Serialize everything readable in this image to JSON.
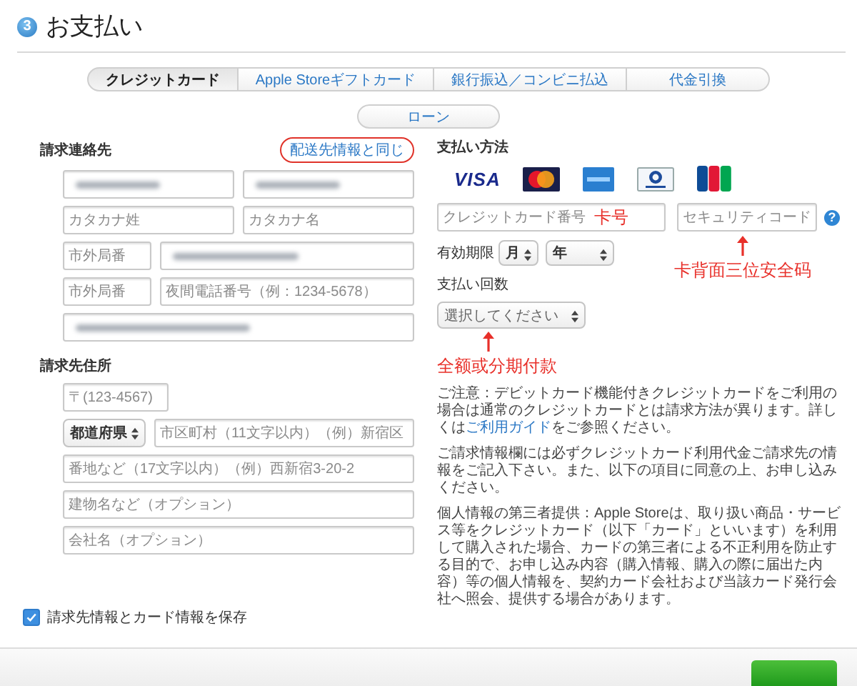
{
  "header": {
    "step": "3",
    "title": "お支払い"
  },
  "tabs": [
    {
      "label": "クレジットカード",
      "selected": true
    },
    {
      "label": "Apple Storeギフトカード",
      "selected": false
    },
    {
      "label": "銀行振込／コンビニ払込",
      "selected": false
    },
    {
      "label": "代金引換",
      "selected": false
    }
  ],
  "loan_button": "ローン",
  "billing_contact": {
    "heading": "請求連絡先",
    "same_as_shipping": {
      "label": "配送先情報と同じ",
      "circled": true
    },
    "rows": [
      [
        {
          "kind": "text",
          "redacted": true
        },
        {
          "kind": "text",
          "redacted": true
        }
      ],
      [
        {
          "kind": "text",
          "placeholder": "カタカナ姓",
          "redacted": false
        },
        {
          "kind": "text",
          "placeholder": "カタカナ名",
          "redacted": false
        }
      ],
      [
        {
          "kind": "area_code",
          "placeholder": "市外局番",
          "redacted": false
        },
        {
          "kind": "text",
          "redacted": true
        }
      ],
      [
        {
          "kind": "area_code",
          "placeholder": "市外局番",
          "redacted": false
        },
        {
          "kind": "text",
          "placeholder": "夜間電話番号（例：1234-5678）",
          "redacted": false
        }
      ],
      [
        {
          "kind": "text",
          "redacted": true
        }
      ]
    ]
  },
  "billing_address": {
    "heading": "請求先住所",
    "rows": [
      [
        {
          "kind": "postal",
          "placeholder": "〒(123-4567)",
          "redacted": false
        }
      ],
      [
        {
          "kind": "select",
          "placeholder": "都道府県"
        },
        {
          "kind": "text",
          "placeholder": "市区町村（11文字以内）（例）新宿区",
          "redacted": false
        }
      ],
      [
        {
          "kind": "text",
          "placeholder": "番地など（17文字以内）（例）西新宿3-20-2",
          "redacted": false
        }
      ],
      [
        {
          "kind": "text",
          "placeholder": "建物名など（オプション）",
          "redacted": false
        }
      ],
      [
        {
          "kind": "text",
          "placeholder": "会社名（オプション）",
          "redacted": false
        }
      ]
    ]
  },
  "payment": {
    "heading": "支払い方法",
    "brands": [
      {
        "kind": "visa",
        "label": "VISA"
      },
      {
        "kind": "mastercard"
      },
      {
        "kind": "amex"
      },
      {
        "kind": "diners"
      },
      {
        "kind": "jcb"
      }
    ],
    "card_number": {
      "placeholder": "クレジットカード番号",
      "annotation": "卡号"
    },
    "security_code": {
      "placeholder": "セキュリティコード",
      "help": "?",
      "annotation": "卡背面三位安全码"
    },
    "expiry": {
      "label": "有効期限",
      "month": "月",
      "year": "年"
    },
    "installments": {
      "label": "支払い回数",
      "value": "選択してください",
      "annotation": "全额或分期付款"
    },
    "notes": [
      {
        "before": "ご注意：デビットカード機能付きクレジットカードをご利用の場合は通常のクレジットカードとは請求方法が異ります。詳しくは",
        "link": "ご利用ガイド",
        "after": "をご参照ください。"
      },
      {
        "before": "ご請求情報欄には必ずクレジットカード利用代金ご請求先の情報をご記入下さい。また、以下の項目に同意の上、お申し込みください。"
      },
      {
        "before": "個人情報の第三者提供：Apple Storeは、取り扱い商品・サービス等をクレジットカード（以下「カード」といいます）を利用して購入された場合、カードの第三者による不正利用を防止する目的で、お申し込み内容（購入情報、購入の際に届出た内容）等の個人情報を、契約カード会社および当該カード発行会社へ照会、提供する場合があります。"
      }
    ]
  },
  "footer": {
    "save_info": {
      "label": "請求先情報とカード情報を保存",
      "checked": true
    }
  }
}
